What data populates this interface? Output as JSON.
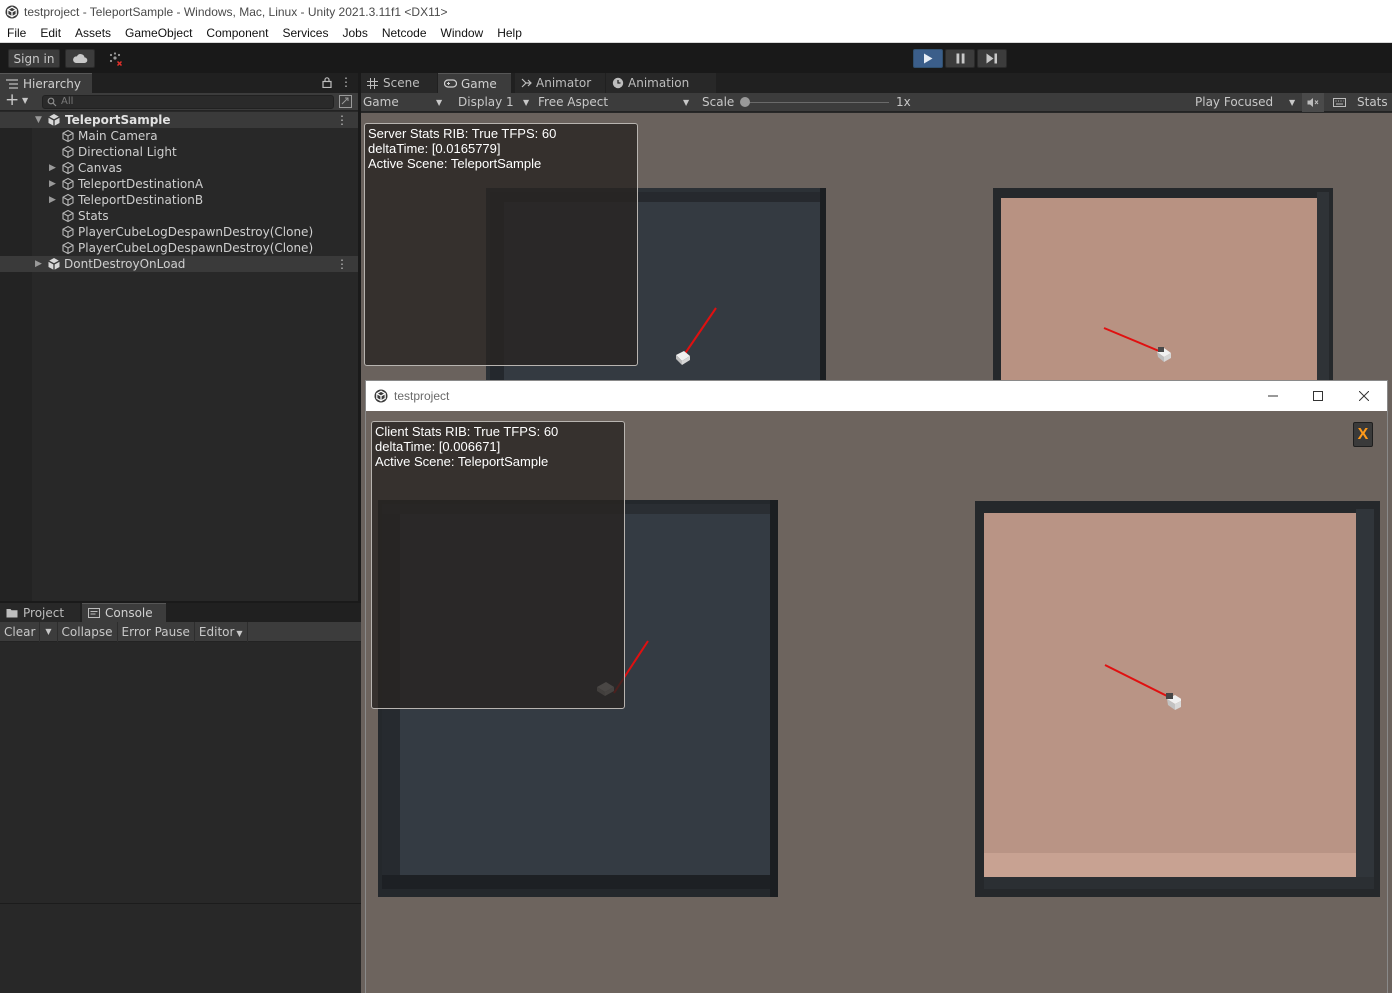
{
  "window": {
    "title": "testproject - TeleportSample - Windows, Mac, Linux - Unity 2021.3.11f1 <DX11>"
  },
  "menu": [
    "File",
    "Edit",
    "Assets",
    "GameObject",
    "Component",
    "Services",
    "Jobs",
    "Netcode",
    "Window",
    "Help"
  ],
  "toolbar": {
    "sign_in": "Sign in",
    "play_state": "playing"
  },
  "hierarchy": {
    "tab_label": "Hierarchy",
    "search_placeholder": "All",
    "scene": "TeleportSample",
    "items": [
      "Main Camera",
      "Directional Light",
      "Canvas",
      "TeleportDestinationA",
      "TeleportDestinationB",
      "Stats",
      "PlayerCubeLogDespawnDestroy(Clone)",
      "PlayerCubeLogDespawnDestroy(Clone)"
    ],
    "dont_destroy": "DontDestroyOnLoad"
  },
  "bottom_panel": {
    "tabs": [
      "Project",
      "Console"
    ],
    "buttons": {
      "clear": "Clear",
      "collapse": "Collapse",
      "error_pause": "Error Pause",
      "editor": "Editor"
    }
  },
  "game_view": {
    "tabs": [
      "Scene",
      "Game",
      "Animator",
      "Animation"
    ],
    "toolbar": {
      "mode": "Game",
      "display": "Display 1",
      "aspect": "Free Aspect",
      "scale_label": "Scale",
      "scale_value": "1x",
      "play_focused": "Play Focused",
      "stats": "Stats"
    },
    "server_stats": {
      "line1": "Server Stats RIB: True TFPS: 60",
      "line2": "deltaTime: [0.0165779]",
      "line3": "Active Scene: TeleportSample"
    }
  },
  "client_window": {
    "title": "testproject",
    "close_x": "X",
    "client_stats": {
      "line1": "Client Stats RIB: True TFPS: 60",
      "line2": "deltaTime: [0.006671]",
      "line3": "Active Scene: TeleportSample"
    }
  },
  "colors": {
    "accent_play": "#3b5e8a",
    "pad_dark": "#2f353b",
    "pad_light": "#b89282",
    "ground": "#6a625d",
    "ray": "#e01010",
    "x_button_text": "#ff9a1a"
  }
}
